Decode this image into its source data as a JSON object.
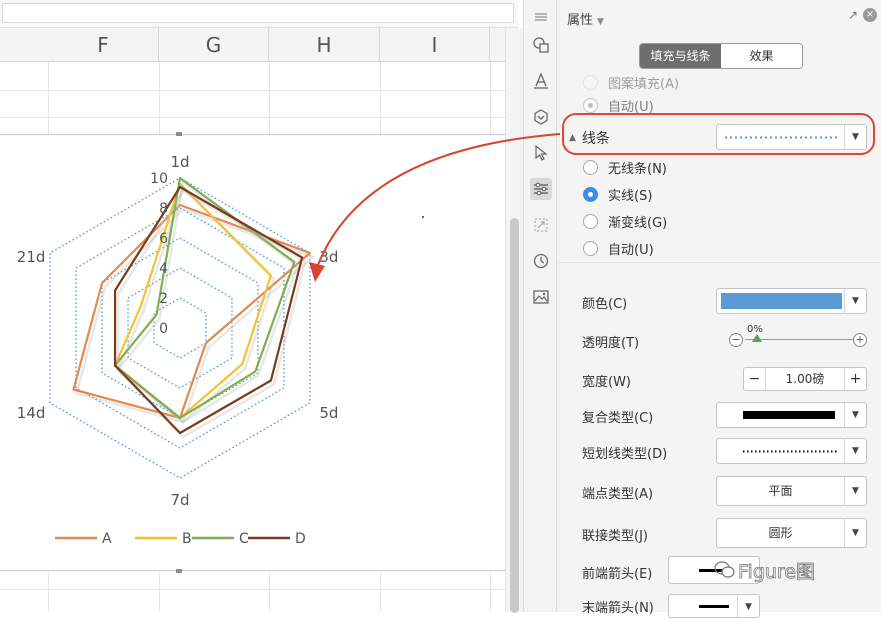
{
  "spreadsheet": {
    "columns": [
      "F",
      "G",
      "H",
      "I"
    ]
  },
  "chart_data": {
    "type": "radar",
    "categories": [
      "1d",
      "3d",
      "5d",
      "7d",
      "14d",
      "21d"
    ],
    "ylim": [
      0,
      10
    ],
    "tick_labels": [
      "0",
      "2",
      "4",
      "6",
      "8",
      "10"
    ],
    "series": [
      {
        "name": "A",
        "color": "#e08a4f",
        "values": [
          8.2,
          10.0,
          2.0,
          6.0,
          8.2,
          6.0
        ]
      },
      {
        "name": "B",
        "color": "#f2c230",
        "values": [
          9.6,
          7.0,
          4.8,
          6.0,
          5.0,
          3.0
        ]
      },
      {
        "name": "C",
        "color": "#7fae52",
        "values": [
          10.0,
          8.8,
          5.8,
          6.0,
          5.0,
          1.8
        ]
      },
      {
        "name": "D",
        "color": "#7a3b1b",
        "values": [
          9.4,
          9.4,
          7.0,
          7.0,
          5.0,
          5.0
        ]
      }
    ],
    "grid_style": "dotted",
    "grid_color": "#5b9bd5",
    "legend_position": "bottom"
  },
  "panel": {
    "title": "属性",
    "tab_fill": "填充与线条",
    "tab_effect": "效果",
    "fill_partial_option": "图案填充(A)",
    "fill_auto_option": "自动(U)",
    "line_section": "线条",
    "line_options": [
      "无线条(N)",
      "实线(S)",
      "渐变线(G)",
      "自动(U)"
    ],
    "selected_line_option": "实线(S)",
    "color_label": "颜色(C)",
    "color_value": "#5b9bd5",
    "transparency_label": "透明度(T)",
    "transparency_value": "0%",
    "width_label": "宽度(W)",
    "width_value": "1.00磅",
    "compound_label": "复合类型(C)",
    "dash_label": "短划线类型(D)",
    "cap_label": "端点类型(A)",
    "cap_value": "平面",
    "join_label": "联接类型(J)",
    "join_value": "圆形",
    "begin_arrow_label": "前端箭头(E)",
    "end_arrow_label": "末端箭头(N)"
  },
  "watermark": "Figure图"
}
